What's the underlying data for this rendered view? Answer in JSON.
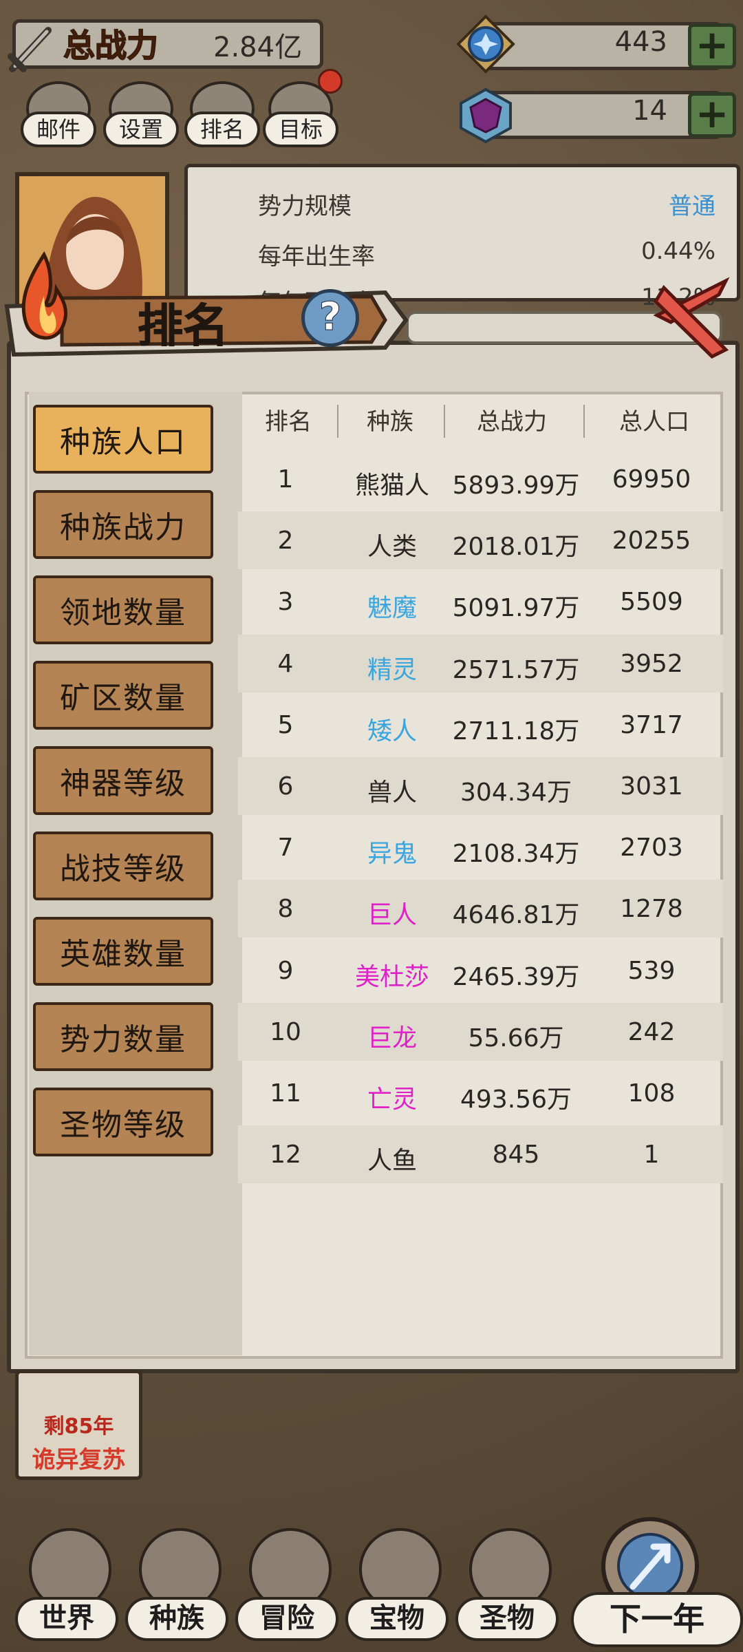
{
  "hud": {
    "power_label": "总战力",
    "power_value": "2.84亿",
    "resource1_value": "443",
    "resource2_value": "14",
    "plus_label": "+"
  },
  "menu": [
    {
      "label": "邮件"
    },
    {
      "label": "设置"
    },
    {
      "label": "排名"
    },
    {
      "label": "目标"
    }
  ],
  "info": {
    "rows": [
      {
        "label": "势力规模",
        "value": "普通"
      },
      {
        "label": "每年出生率",
        "value": "0.44%"
      },
      {
        "label": "每年死亡率",
        "value": "11.2%"
      }
    ]
  },
  "modal": {
    "title": "排名",
    "help": "?",
    "tabs": [
      {
        "label": "种族人口"
      },
      {
        "label": "种族战力"
      },
      {
        "label": "领地数量"
      },
      {
        "label": "矿区数量"
      },
      {
        "label": "神器等级"
      },
      {
        "label": "战技等级"
      },
      {
        "label": "英雄数量"
      },
      {
        "label": "势力数量"
      },
      {
        "label": "圣物等级"
      }
    ],
    "columns": [
      "排名",
      "种族",
      "总战力",
      "总人口"
    ],
    "rows": [
      {
        "rank": "1",
        "race": "熊猫人",
        "power": "5893.99万",
        "pop": "69950",
        "color": "#2a2623"
      },
      {
        "rank": "2",
        "race": "人类",
        "power": "2018.01万",
        "pop": "20255",
        "color": "#2a2623"
      },
      {
        "rank": "3",
        "race": "魅魔",
        "power": "5091.97万",
        "pop": "5509",
        "color": "#3aa6e0"
      },
      {
        "rank": "4",
        "race": "精灵",
        "power": "2571.57万",
        "pop": "3952",
        "color": "#3aa6e0"
      },
      {
        "rank": "5",
        "race": "矮人",
        "power": "2711.18万",
        "pop": "3717",
        "color": "#3aa6e0"
      },
      {
        "rank": "6",
        "race": "兽人",
        "power": "304.34万",
        "pop": "3031",
        "color": "#2a2623"
      },
      {
        "rank": "7",
        "race": "异鬼",
        "power": "2108.34万",
        "pop": "2703",
        "color": "#3aa6e0"
      },
      {
        "rank": "8",
        "race": "巨人",
        "power": "4646.81万",
        "pop": "1278",
        "color": "#e020c8"
      },
      {
        "rank": "9",
        "race": "美杜莎",
        "power": "2465.39万",
        "pop": "539",
        "color": "#e020c8"
      },
      {
        "rank": "10",
        "race": "巨龙",
        "power": "55.66万",
        "pop": "242",
        "color": "#e020c8"
      },
      {
        "rank": "11",
        "race": "亡灵",
        "power": "493.56万",
        "pop": "108",
        "color": "#e020c8"
      },
      {
        "rank": "12",
        "race": "人鱼",
        "power": "845",
        "pop": "1",
        "color": "#2a2623"
      }
    ]
  },
  "event": {
    "line1": "剩85年",
    "line2": "诡异复苏"
  },
  "nav": [
    {
      "label": "世界"
    },
    {
      "label": "种族"
    },
    {
      "label": "冒险"
    },
    {
      "label": "宝物"
    },
    {
      "label": "圣物"
    },
    {
      "label": "下一年"
    }
  ]
}
